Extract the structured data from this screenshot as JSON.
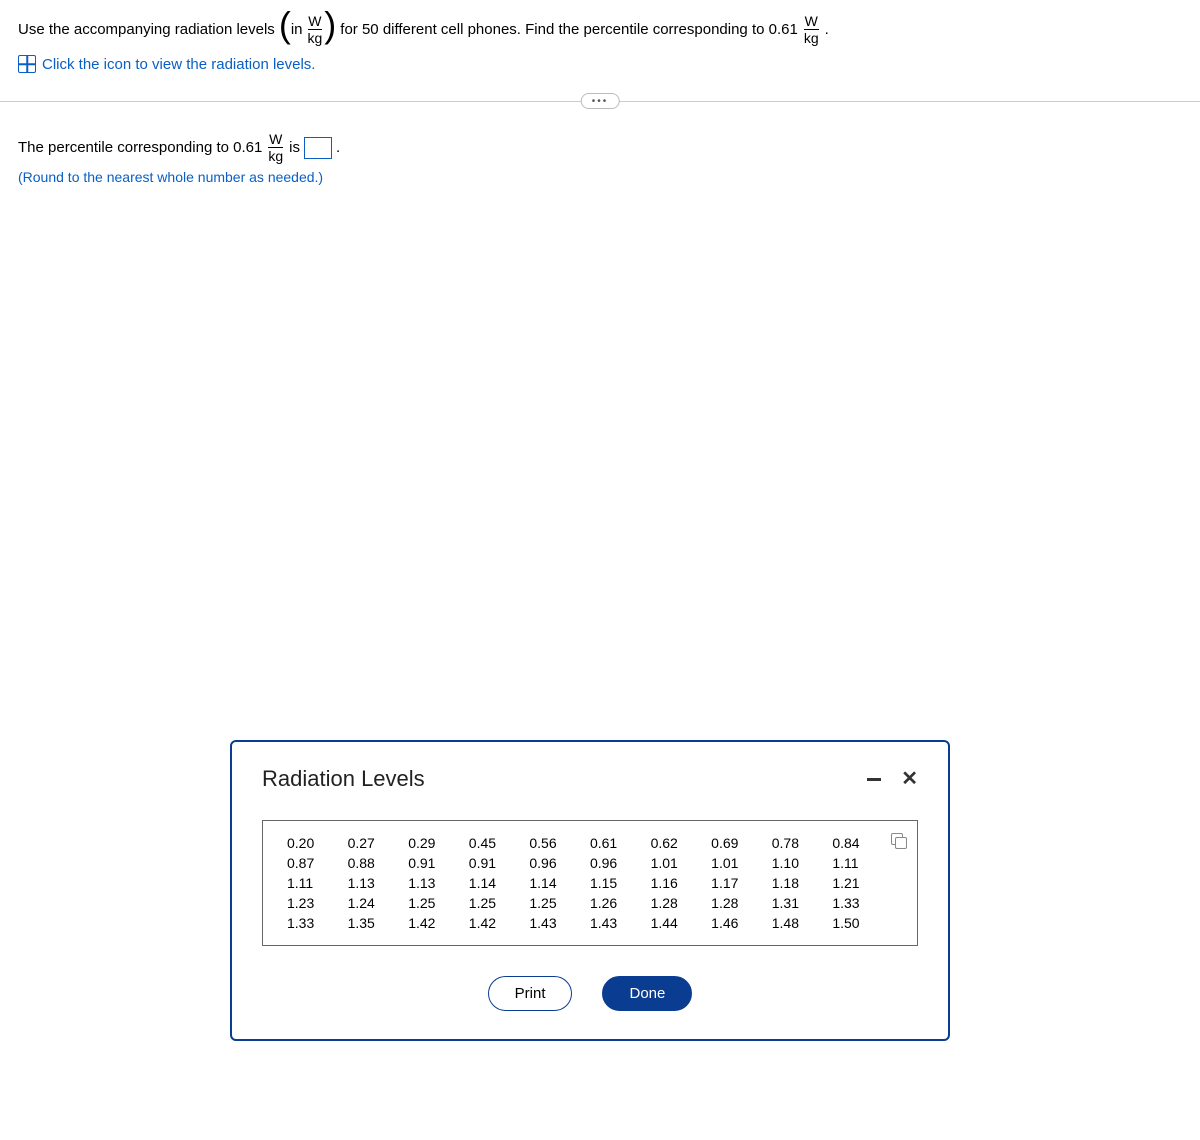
{
  "question": {
    "part1": "Use the accompanying radiation levels",
    "paren_in": "in",
    "unit_num": "W",
    "unit_den": "kg",
    "part2": "for 50 different cell phones. Find the percentile corresponding to 0.61",
    "period": "."
  },
  "link": {
    "text": "Click the icon to view the radiation levels."
  },
  "pill_label": "•••",
  "answer": {
    "prefix": "The percentile corresponding to 0.61",
    "mid": "is",
    "suffix": ".",
    "value": "",
    "hint": "(Round to the nearest whole number as needed.)"
  },
  "dialog": {
    "title": "Radiation Levels",
    "rows": [
      [
        "0.20",
        "0.27",
        "0.29",
        "0.45",
        "0.56",
        "0.61",
        "0.62",
        "0.69",
        "0.78",
        "0.84"
      ],
      [
        "0.87",
        "0.88",
        "0.91",
        "0.91",
        "0.96",
        "0.96",
        "1.01",
        "1.01",
        "1.10",
        "1.11"
      ],
      [
        "1.11",
        "1.13",
        "1.13",
        "1.14",
        "1.14",
        "1.15",
        "1.16",
        "1.17",
        "1.18",
        "1.21"
      ],
      [
        "1.23",
        "1.24",
        "1.25",
        "1.25",
        "1.25",
        "1.26",
        "1.28",
        "1.28",
        "1.31",
        "1.33"
      ],
      [
        "1.33",
        "1.35",
        "1.42",
        "1.42",
        "1.43",
        "1.43",
        "1.44",
        "1.46",
        "1.48",
        "1.50"
      ]
    ],
    "print_label": "Print",
    "done_label": "Done"
  }
}
